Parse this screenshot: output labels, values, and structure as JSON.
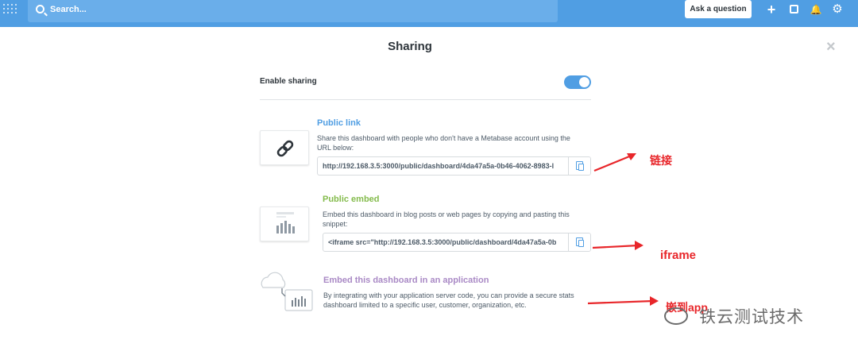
{
  "topbar": {
    "search_placeholder": "Search...",
    "ask_button": "Ask a question",
    "plus_icon": "+",
    "bell_icon": "🔔",
    "gear_icon": "⚙"
  },
  "modal": {
    "title": "Sharing",
    "close_icon": "×",
    "enable_label": "Enable sharing",
    "toggle_on": true,
    "public_link": {
      "title": "Public link",
      "desc_line1": "Share this dashboard with people who don't have a Metabase account using the",
      "desc_line2": "URL below:",
      "url": "http://192.168.3.5:3000/public/dashboard/4da47a5a-0b46-4062-8983-l"
    },
    "public_embed": {
      "title": "Public embed",
      "desc_line1": "Embed this dashboard in blog posts or web pages by copying and pasting this",
      "desc_line2": "snippet:",
      "snippet": "<iframe   src=\"http://192.168.3.5:3000/public/dashboard/4da47a5a-0b"
    },
    "app_embed": {
      "title": "Embed this dashboard in an application",
      "desc_line1": "By integrating with your application server code, you can provide a secure stats",
      "desc_line2": "dashboard limited to a specific user, customer, organization, etc."
    }
  },
  "annotations": {
    "link": "链接",
    "iframe": "iframe",
    "app": "嵌到app"
  },
  "watermark": "铁云测试技术",
  "colors": {
    "brand": "#509ee3",
    "public_link": "#509ee3",
    "public_embed": "#84bb4c",
    "app_embed": "#a989c5",
    "annotation": "#e8262a"
  }
}
